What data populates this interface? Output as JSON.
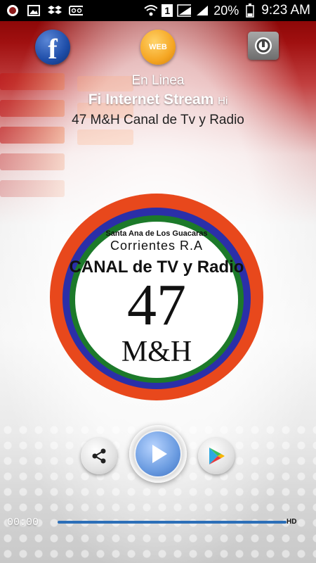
{
  "status_bar": {
    "network_type": "1",
    "battery": "20%",
    "time": "9:23 AM",
    "icons": [
      "app-notification-icon",
      "image-icon",
      "dropbox-icon",
      "voicemail-icon",
      "wifi-icon",
      "signal-icon",
      "battery-icon"
    ]
  },
  "top_bar": {
    "facebook_letter": "f",
    "web_label": "WEB"
  },
  "now_playing": {
    "status": "En Linea",
    "stream_name": "Fi Internet Stream",
    "quality": "Hi",
    "station": "47 M&H Canal de Tv y Radio"
  },
  "logo": {
    "line1": "Santa Ana de Los Guacaras",
    "line2": "Corrientes  R.A",
    "line3": "CANAL de TV y Radio",
    "number": "47",
    "initials": "M&H",
    "ring_colors": [
      "#e8481c",
      "#2b2fa8",
      "#1c7a2a"
    ]
  },
  "player": {
    "elapsed": "00:00",
    "quality_badge": "HD",
    "progress_color": "#2c6fb8"
  }
}
